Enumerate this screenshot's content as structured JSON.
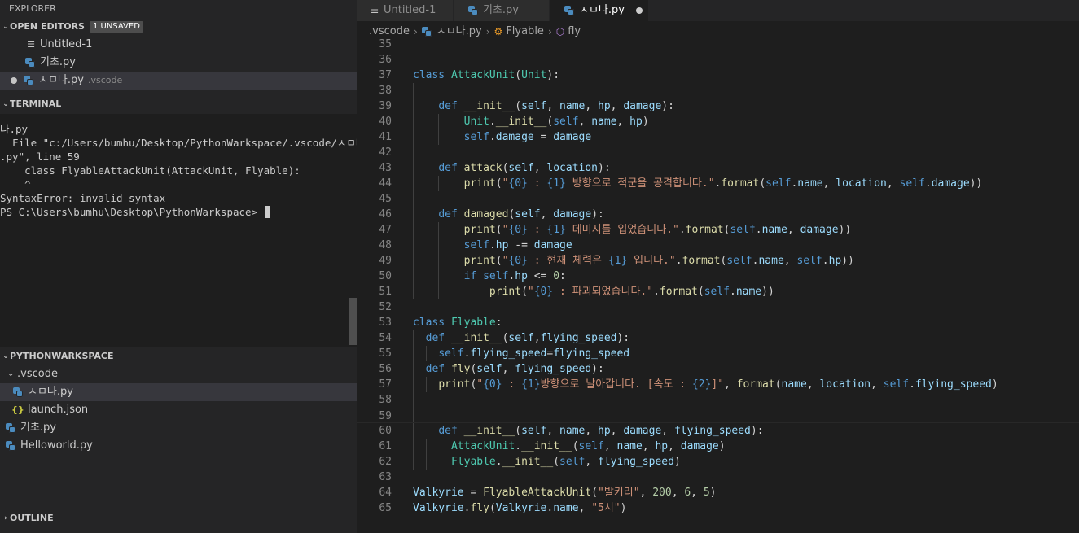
{
  "explorer": {
    "title": "EXPLORER",
    "open_editors": {
      "header": "OPEN EDITORS",
      "badge": "1 UNSAVED",
      "items": [
        {
          "name": "Untitled-1",
          "desc": ""
        },
        {
          "name": "기초.py",
          "desc": ""
        },
        {
          "name": "ㅅㅁ나.py",
          "desc": ".vscode"
        }
      ]
    },
    "terminal": {
      "header": "TERMINAL",
      "lines": [
        "나.py",
        "  File \"c:/Users/bumhu/Desktop/PythonWarkspace/.vscode/ㅅㅁ나",
        ".py\", line 59",
        "    class FlyableAttackUnit(AttackUnit, Flyable):",
        "    ^",
        "SyntaxError: invalid syntax",
        "PS C:\\Users\\bumhu\\Desktop\\PythonWarkspace> "
      ]
    },
    "workspace": {
      "header": "PYTHONWARKSPACE",
      "folder": ".vscode",
      "folder_items": [
        "ㅅㅁ나.py",
        "launch.json"
      ],
      "root_items": [
        "기초.py",
        "Helloworld.py"
      ]
    },
    "outline": {
      "header": "OUTLINE"
    }
  },
  "editor": {
    "tabs": [
      {
        "label": "Untitled-1",
        "icon": "text-file-icon",
        "active": false
      },
      {
        "label": "기초.py",
        "icon": "python-icon",
        "active": false
      },
      {
        "label": "ㅅㅁ나.py",
        "icon": "python-icon",
        "active": true,
        "dirty": true
      }
    ],
    "breadcrumb": [
      ".vscode",
      "ㅅㅁ나.py",
      "Flyable",
      "fly"
    ]
  },
  "code_lines": [
    {
      "n": 35,
      "t": [
        [
          ""
        ]
      ]
    },
    {
      "n": 36,
      "t": [
        [
          ""
        ]
      ]
    },
    {
      "n": 37,
      "t": [
        [
          "kw",
          "class "
        ],
        [
          "cls",
          "AttackUnit"
        ],
        [
          "pl",
          "("
        ],
        [
          "cls",
          "Unit"
        ],
        [
          "pl",
          "):"
        ]
      ]
    },
    {
      "n": 38,
      "t": [
        [
          ""
        ]
      ]
    },
    {
      "n": 39,
      "t": [
        [
          "pl",
          "    "
        ],
        [
          "kw",
          "def "
        ],
        [
          "fn",
          "__init__"
        ],
        [
          "pl",
          "("
        ],
        [
          "var",
          "self"
        ],
        [
          "pl",
          ", "
        ],
        [
          "var",
          "name"
        ],
        [
          "pl",
          ", "
        ],
        [
          "var",
          "hp"
        ],
        [
          "pl",
          ", "
        ],
        [
          "var",
          "damage"
        ],
        [
          "pl",
          "):"
        ]
      ]
    },
    {
      "n": 40,
      "t": [
        [
          "pl",
          "        "
        ],
        [
          "cls",
          "Unit"
        ],
        [
          "pl",
          "."
        ],
        [
          "fn",
          "__init__"
        ],
        [
          "pl",
          "("
        ],
        [
          "kw",
          "self"
        ],
        [
          "pl",
          ", "
        ],
        [
          "var",
          "name"
        ],
        [
          "pl",
          ", "
        ],
        [
          "var",
          "hp"
        ],
        [
          "pl",
          ")"
        ]
      ]
    },
    {
      "n": 41,
      "t": [
        [
          "pl",
          "        "
        ],
        [
          "kw",
          "self"
        ],
        [
          "pl",
          "."
        ],
        [
          "var",
          "damage"
        ],
        [
          "pl",
          " = "
        ],
        [
          "var",
          "damage"
        ]
      ]
    },
    {
      "n": 42,
      "t": [
        [
          ""
        ]
      ]
    },
    {
      "n": 43,
      "t": [
        [
          "pl",
          "    "
        ],
        [
          "kw",
          "def "
        ],
        [
          "fn",
          "attack"
        ],
        [
          "pl",
          "("
        ],
        [
          "var",
          "self"
        ],
        [
          "pl",
          ", "
        ],
        [
          "var",
          "location"
        ],
        [
          "pl",
          "):"
        ]
      ]
    },
    {
      "n": 44,
      "t": [
        [
          "pl",
          "        "
        ],
        [
          "fn",
          "print"
        ],
        [
          "pl",
          "("
        ],
        [
          "str",
          "\""
        ],
        [
          "fmt",
          "{0}"
        ],
        [
          "str",
          " : "
        ],
        [
          "fmt",
          "{1}"
        ],
        [
          "str",
          " 방향으로 적군을 공격합니다.\""
        ],
        [
          "pl",
          "."
        ],
        [
          "fn",
          "format"
        ],
        [
          "pl",
          "("
        ],
        [
          "kw",
          "self"
        ],
        [
          "pl",
          "."
        ],
        [
          "var",
          "name"
        ],
        [
          "pl",
          ", "
        ],
        [
          "var",
          "location"
        ],
        [
          "pl",
          ", "
        ],
        [
          "kw",
          "self"
        ],
        [
          "pl",
          "."
        ],
        [
          "var",
          "damage"
        ],
        [
          "pl",
          "))"
        ]
      ]
    },
    {
      "n": 45,
      "t": [
        [
          ""
        ]
      ]
    },
    {
      "n": 46,
      "t": [
        [
          "pl",
          "    "
        ],
        [
          "kw",
          "def "
        ],
        [
          "fn",
          "damaged"
        ],
        [
          "pl",
          "("
        ],
        [
          "var",
          "self"
        ],
        [
          "pl",
          ", "
        ],
        [
          "var",
          "damage"
        ],
        [
          "pl",
          "):"
        ]
      ]
    },
    {
      "n": 47,
      "t": [
        [
          "pl",
          "        "
        ],
        [
          "fn",
          "print"
        ],
        [
          "pl",
          "("
        ],
        [
          "str",
          "\""
        ],
        [
          "fmt",
          "{0}"
        ],
        [
          "str",
          " : "
        ],
        [
          "fmt",
          "{1}"
        ],
        [
          "str",
          " 데미지를 입었습니다.\""
        ],
        [
          "pl",
          "."
        ],
        [
          "fn",
          "format"
        ],
        [
          "pl",
          "("
        ],
        [
          "kw",
          "self"
        ],
        [
          "pl",
          "."
        ],
        [
          "var",
          "name"
        ],
        [
          "pl",
          ", "
        ],
        [
          "var",
          "damage"
        ],
        [
          "pl",
          "))"
        ]
      ]
    },
    {
      "n": 48,
      "t": [
        [
          "pl",
          "        "
        ],
        [
          "kw",
          "self"
        ],
        [
          "pl",
          "."
        ],
        [
          "var",
          "hp"
        ],
        [
          "pl",
          " -= "
        ],
        [
          "var",
          "damage"
        ]
      ]
    },
    {
      "n": 49,
      "t": [
        [
          "pl",
          "        "
        ],
        [
          "fn",
          "print"
        ],
        [
          "pl",
          "("
        ],
        [
          "str",
          "\""
        ],
        [
          "fmt",
          "{0}"
        ],
        [
          "str",
          " : 현재 체력은 "
        ],
        [
          "fmt",
          "{1}"
        ],
        [
          "str",
          " 입니다.\""
        ],
        [
          "pl",
          "."
        ],
        [
          "fn",
          "format"
        ],
        [
          "pl",
          "("
        ],
        [
          "kw",
          "self"
        ],
        [
          "pl",
          "."
        ],
        [
          "var",
          "name"
        ],
        [
          "pl",
          ", "
        ],
        [
          "kw",
          "self"
        ],
        [
          "pl",
          "."
        ],
        [
          "var",
          "hp"
        ],
        [
          "pl",
          "))"
        ]
      ]
    },
    {
      "n": 50,
      "t": [
        [
          "pl",
          "        "
        ],
        [
          "kw",
          "if "
        ],
        [
          "kw",
          "self"
        ],
        [
          "pl",
          "."
        ],
        [
          "var",
          "hp"
        ],
        [
          "pl",
          " <= "
        ],
        [
          "num",
          "0"
        ],
        [
          "pl",
          ":"
        ]
      ]
    },
    {
      "n": 51,
      "t": [
        [
          "pl",
          "            "
        ],
        [
          "fn",
          "print"
        ],
        [
          "pl",
          "("
        ],
        [
          "str",
          "\""
        ],
        [
          "fmt",
          "{0}"
        ],
        [
          "str",
          " : 파괴되었습니다.\""
        ],
        [
          "pl",
          "."
        ],
        [
          "fn",
          "format"
        ],
        [
          "pl",
          "("
        ],
        [
          "kw",
          "self"
        ],
        [
          "pl",
          "."
        ],
        [
          "var",
          "name"
        ],
        [
          "pl",
          "))"
        ]
      ]
    },
    {
      "n": 52,
      "t": [
        [
          ""
        ]
      ]
    },
    {
      "n": 53,
      "t": [
        [
          "kw",
          "class "
        ],
        [
          "cls",
          "Flyable"
        ],
        [
          "pl",
          ":"
        ]
      ]
    },
    {
      "n": 54,
      "t": [
        [
          "pl",
          "  "
        ],
        [
          "kw",
          "def "
        ],
        [
          "fn",
          "__init__"
        ],
        [
          "pl",
          "("
        ],
        [
          "var",
          "self"
        ],
        [
          "pl",
          ","
        ],
        [
          "var",
          "flying_speed"
        ],
        [
          "pl",
          "):"
        ]
      ]
    },
    {
      "n": 55,
      "t": [
        [
          "pl",
          "    "
        ],
        [
          "kw",
          "self"
        ],
        [
          "pl",
          "."
        ],
        [
          "var",
          "flying_speed"
        ],
        [
          "pl",
          "="
        ],
        [
          "var",
          "flying_speed"
        ]
      ]
    },
    {
      "n": 56,
      "t": [
        [
          "pl",
          "  "
        ],
        [
          "kw",
          "def "
        ],
        [
          "fn",
          "fly"
        ],
        [
          "pl",
          "("
        ],
        [
          "var",
          "self"
        ],
        [
          "pl",
          ", "
        ],
        [
          "var",
          "flying_speed"
        ],
        [
          "pl",
          "):"
        ]
      ]
    },
    {
      "n": 57,
      "t": [
        [
          "pl",
          "    "
        ],
        [
          "fn",
          "print"
        ],
        [
          "pl",
          "("
        ],
        [
          "str",
          "\""
        ],
        [
          "fmt",
          "{0}"
        ],
        [
          "str",
          " : "
        ],
        [
          "fmt",
          "{1}"
        ],
        [
          "str",
          "방향으로 날아갑니다. [속도 : "
        ],
        [
          "fmt",
          "{2}"
        ],
        [
          "str",
          "]\""
        ],
        [
          "pl",
          ", "
        ],
        [
          "fn",
          "format"
        ],
        [
          "pl",
          "("
        ],
        [
          "var",
          "name"
        ],
        [
          "pl",
          ", "
        ],
        [
          "var",
          "location"
        ],
        [
          "pl",
          ", "
        ],
        [
          "kw",
          "self"
        ],
        [
          "pl",
          "."
        ],
        [
          "var",
          "flying_speed"
        ],
        [
          "pl",
          ")"
        ]
      ]
    },
    {
      "n": 58,
      "t": [
        [
          ""
        ]
      ]
    },
    {
      "n": 59,
      "t": [
        [
          ""
        ]
      ],
      "current": true
    },
    {
      "n": 60,
      "t": [
        [
          "pl",
          "    "
        ],
        [
          "kw",
          "def "
        ],
        [
          "fn",
          "__init__"
        ],
        [
          "pl",
          "("
        ],
        [
          "var",
          "self"
        ],
        [
          "pl",
          ", "
        ],
        [
          "var",
          "name"
        ],
        [
          "pl",
          ", "
        ],
        [
          "var",
          "hp"
        ],
        [
          "pl",
          ", "
        ],
        [
          "var",
          "damage"
        ],
        [
          "pl",
          ", "
        ],
        [
          "var",
          "flying_speed"
        ],
        [
          "pl",
          "):"
        ]
      ]
    },
    {
      "n": 61,
      "t": [
        [
          "pl",
          "      "
        ],
        [
          "cls",
          "AttackUnit"
        ],
        [
          "pl",
          "."
        ],
        [
          "fn",
          "__init__"
        ],
        [
          "pl",
          "("
        ],
        [
          "kw",
          "self"
        ],
        [
          "pl",
          ", "
        ],
        [
          "var",
          "name"
        ],
        [
          "pl",
          ", "
        ],
        [
          "var",
          "hp"
        ],
        [
          "pl",
          ", "
        ],
        [
          "var",
          "damage"
        ],
        [
          "pl",
          ")"
        ]
      ]
    },
    {
      "n": 62,
      "t": [
        [
          "pl",
          "      "
        ],
        [
          "cls",
          "Flyable"
        ],
        [
          "pl",
          "."
        ],
        [
          "fn",
          "__init__"
        ],
        [
          "pl",
          "("
        ],
        [
          "kw",
          "self"
        ],
        [
          "pl",
          ", "
        ],
        [
          "var",
          "flying_speed"
        ],
        [
          "pl",
          ")"
        ]
      ]
    },
    {
      "n": 63,
      "t": [
        [
          ""
        ]
      ]
    },
    {
      "n": 64,
      "t": [
        [
          "var",
          "Valkyrie"
        ],
        [
          "pl",
          " = "
        ],
        [
          "fn",
          "FlyableAttackUnit"
        ],
        [
          "pl",
          "("
        ],
        [
          "str",
          "\"발키리\""
        ],
        [
          "pl",
          ", "
        ],
        [
          "num",
          "200"
        ],
        [
          "pl",
          ", "
        ],
        [
          "num",
          "6"
        ],
        [
          "pl",
          ", "
        ],
        [
          "num",
          "5"
        ],
        [
          "pl",
          ")"
        ]
      ]
    },
    {
      "n": 65,
      "t": [
        [
          "var",
          "Valkyrie"
        ],
        [
          "pl",
          "."
        ],
        [
          "fn",
          "fly"
        ],
        [
          "pl",
          "("
        ],
        [
          "var",
          "Valkyrie"
        ],
        [
          "pl",
          "."
        ],
        [
          "var",
          "name"
        ],
        [
          "pl",
          ", "
        ],
        [
          "str",
          "\"5시\""
        ],
        [
          "pl",
          ")"
        ]
      ]
    }
  ]
}
